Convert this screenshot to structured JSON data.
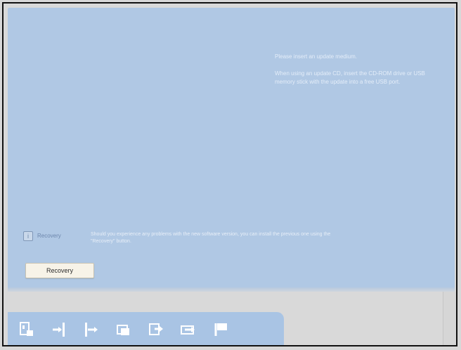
{
  "main": {
    "instructions": [
      "Please insert an update medium.",
      "When using an update CD, insert the CD-ROM drive or USB memory stick with the update into a free USB port."
    ],
    "recovery": {
      "title": "Recovery",
      "description": "Should you experience any problems with the new software version, you can install the previous one using the \"Recovery\" button.",
      "button_label": "Recovery"
    }
  },
  "toolbar": {
    "icons": [
      "device-card-icon",
      "import-icon",
      "export-icon",
      "copy-icon",
      "forward-icon",
      "transfer-icon",
      "flag-icon"
    ]
  },
  "colors": {
    "panel_blue": "#b0c8e4",
    "toolbar_blue": "#a9c4e4",
    "button_bg": "#f7f3e8"
  }
}
